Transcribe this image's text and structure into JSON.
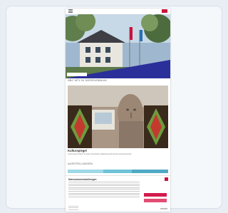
{
  "colors": {
    "background": "#e9eef4",
    "accent": "#c8143c",
    "banner_blue": "#2b2f9a",
    "button_primary": "#d41b4d"
  },
  "icons": {
    "menu": "hamburger-icon",
    "language": "flag-icon",
    "close": "close-icon"
  },
  "hero": {
    "caption": "ABC MTL IN SIERENSBAUM"
  },
  "artwork": {
    "title": "Kulturspiegel",
    "description": "Lorem ipsum dolor sit amet consectetur adipiscing elit sed do eiusmod tempor."
  },
  "section": {
    "title": "Ausstellungen"
  },
  "cookie": {
    "title": "Datenschutzeinstellungen"
  }
}
